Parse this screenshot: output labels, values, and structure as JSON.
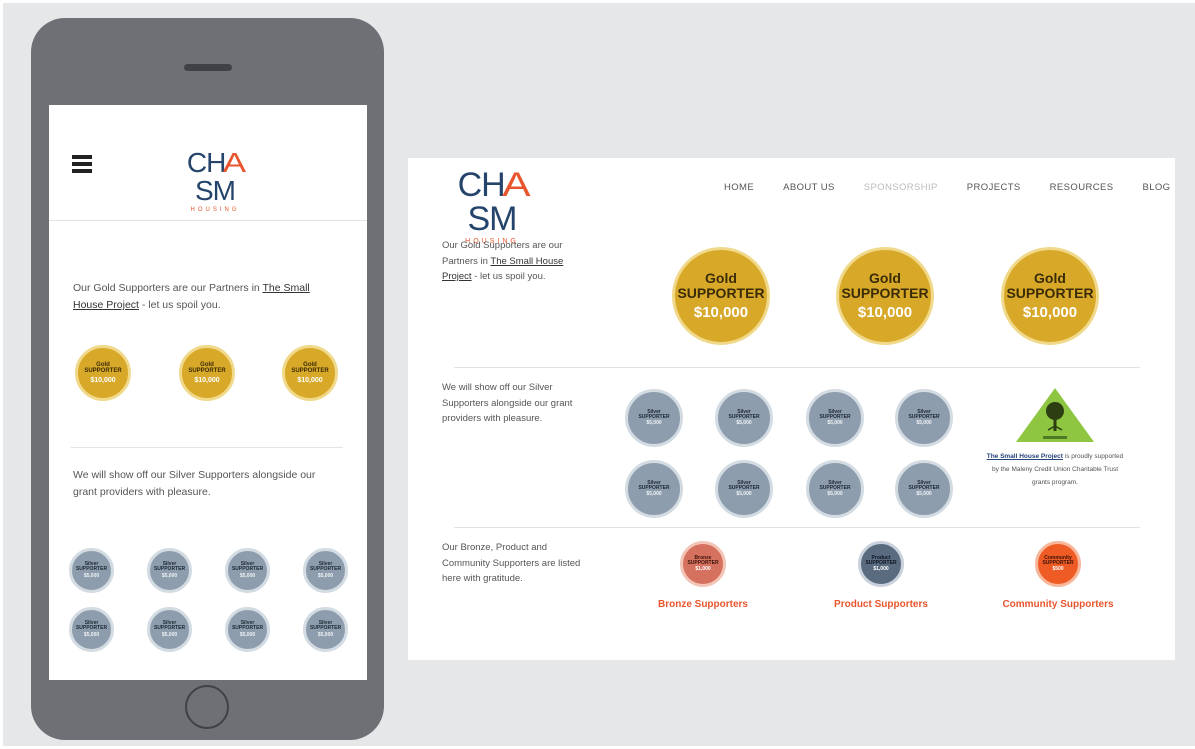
{
  "brand": {
    "name_prefix": "CH",
    "name_accent": "A",
    "name_suffix": "SM",
    "sub": "HOUSING",
    "primary_color": "#25446c",
    "accent_color": "#e8552d"
  },
  "nav": {
    "items": [
      "HOME",
      "ABOUT US",
      "SPONSORSHIP",
      "PROJECTS",
      "RESOURCES",
      "BLOG"
    ],
    "active": "SPONSORSHIP"
  },
  "mobile": {
    "gold_text": "Our Gold Supporters are our Partners in ",
    "gold_link": "The Small House Project",
    "gold_text_after": " - let us spoil you.",
    "silver_text": "We will show off our Silver Supporters alongside our grant providers with pleasure."
  },
  "desktop": {
    "gold_text": "Our Gold Supporters are our Partners in ",
    "gold_link": "The Small House Project",
    "gold_text_after": " - let us spoil you.",
    "silver_text": "We will show off our Silver Supporters alongside our grant providers with pleasure.",
    "bronze_text": "Our Bronze, Product and Community Supporters are listed here with gratitude.",
    "shp_link": "The Small House Project",
    "shp_text": " is proudly supported by the Maleny Credit Union Charitable Trust grants program."
  },
  "badges": {
    "gold": {
      "l1": "Gold",
      "l2": "SUPPORTER",
      "amount": "$10,000"
    },
    "silver": {
      "l1": "Silver",
      "l2": "SUPPORTER",
      "amount": "$5,000"
    },
    "bronze": {
      "l1": "Bronze",
      "l2": "SUPPORTER",
      "amount": "$1,000"
    },
    "product": {
      "l1": "Product",
      "l2": "SUPPORTER",
      "amount": "$1,000"
    },
    "community": {
      "l1": "Community",
      "l2": "SUPPORTER",
      "amount": "$500"
    }
  },
  "supporter_links": {
    "bronze": "Bronze Supporters",
    "product": "Product Supporters",
    "community": "Community Supporters"
  },
  "icons": {
    "menu": "hamburger-icon",
    "phone_home": "home-button-icon",
    "grant_logo": "tree-triangle-logo"
  }
}
